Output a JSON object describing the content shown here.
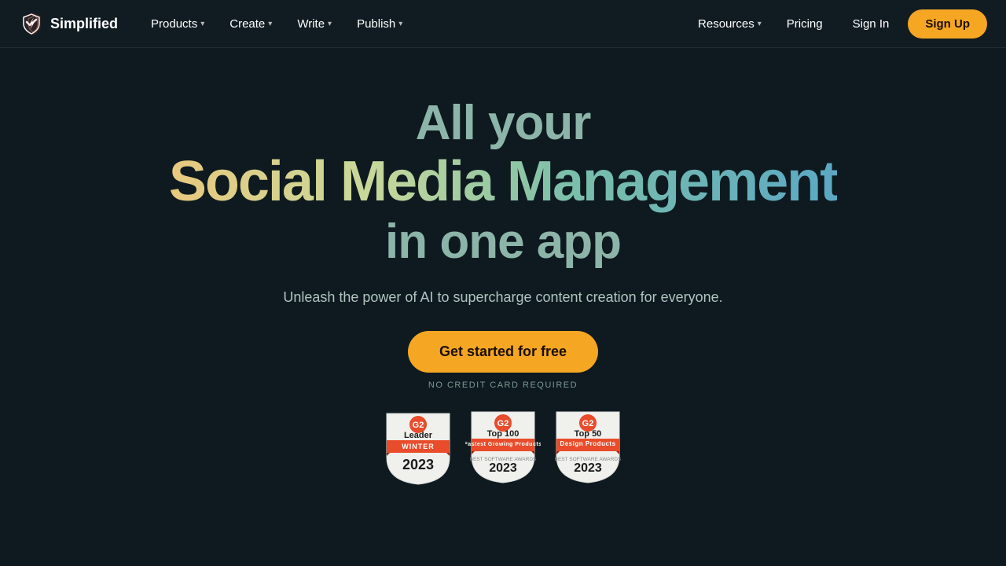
{
  "nav": {
    "logo_text": "Simplified",
    "items": [
      {
        "label": "Products",
        "has_chevron": true
      },
      {
        "label": "Create",
        "has_chevron": true
      },
      {
        "label": "Write",
        "has_chevron": true
      },
      {
        "label": "Publish",
        "has_chevron": true
      }
    ],
    "right_items": [
      {
        "label": "Resources",
        "has_chevron": true
      },
      {
        "label": "Pricing",
        "has_chevron": false
      }
    ],
    "signin_label": "Sign In",
    "signup_label": "Sign Up"
  },
  "hero": {
    "line1": "All your",
    "line2": "Social Media Management",
    "line3": "in one app",
    "subtitle": "Unleash the power of AI to supercharge content creation for everyone.",
    "cta_label": "Get started for free",
    "no_cc_label": "NO CREDIT CARD REQUIRED"
  },
  "badges": [
    {
      "type": "Leader",
      "ribbon": "WINTER",
      "year": "2023"
    },
    {
      "type": "Top 100",
      "subtitle": "Fastest Growing Products",
      "award": "BEST SOFTWARE AWARDS",
      "year": "2023"
    },
    {
      "type": "Top 50",
      "subtitle": "Design Products",
      "award": "BEST SOFTWARE AWARDS",
      "year": "2023"
    }
  ]
}
